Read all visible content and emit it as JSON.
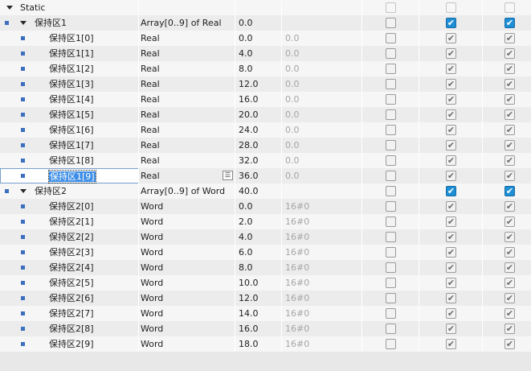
{
  "section": {
    "label": "Static"
  },
  "colors": {
    "accent": "#1f8fd4",
    "marker": "#3c6fbf",
    "row_odd": "#ececec",
    "row_even": "#f6f6f6",
    "selection": "#3d8ee6"
  },
  "rows": [
    {
      "name": "保持区1",
      "type": "Array[0..9] of Real",
      "offset": "0.0",
      "start": "",
      "level": 0,
      "marker": true,
      "expanded": true,
      "checks": [
        "unchecked",
        "blue",
        "blue"
      ]
    },
    {
      "name": "保持区1[0]",
      "type": "Real",
      "offset": "0.0",
      "start": "0.0",
      "level": 1,
      "marker": true,
      "checks": [
        "unchecked",
        "checked",
        "checked"
      ]
    },
    {
      "name": "保持区1[1]",
      "type": "Real",
      "offset": "4.0",
      "start": "0.0",
      "level": 1,
      "marker": true,
      "checks": [
        "unchecked",
        "checked",
        "checked"
      ]
    },
    {
      "name": "保持区1[2]",
      "type": "Real",
      "offset": "8.0",
      "start": "0.0",
      "level": 1,
      "marker": true,
      "checks": [
        "unchecked",
        "checked",
        "checked"
      ]
    },
    {
      "name": "保持区1[3]",
      "type": "Real",
      "offset": "12.0",
      "start": "0.0",
      "level": 1,
      "marker": true,
      "checks": [
        "unchecked",
        "checked",
        "checked"
      ]
    },
    {
      "name": "保持区1[4]",
      "type": "Real",
      "offset": "16.0",
      "start": "0.0",
      "level": 1,
      "marker": true,
      "checks": [
        "unchecked",
        "checked",
        "checked"
      ]
    },
    {
      "name": "保持区1[5]",
      "type": "Real",
      "offset": "20.0",
      "start": "0.0",
      "level": 1,
      "marker": true,
      "checks": [
        "unchecked",
        "checked",
        "checked"
      ]
    },
    {
      "name": "保持区1[6]",
      "type": "Real",
      "offset": "24.0",
      "start": "0.0",
      "level": 1,
      "marker": true,
      "checks": [
        "unchecked",
        "checked",
        "checked"
      ]
    },
    {
      "name": "保持区1[7]",
      "type": "Real",
      "offset": "28.0",
      "start": "0.0",
      "level": 1,
      "marker": true,
      "checks": [
        "unchecked",
        "checked",
        "checked"
      ]
    },
    {
      "name": "保持区1[8]",
      "type": "Real",
      "offset": "32.0",
      "start": "0.0",
      "level": 1,
      "marker": true,
      "checks": [
        "unchecked",
        "checked",
        "checked"
      ]
    },
    {
      "name": "保持区1[9]",
      "type": "Real",
      "offset": "36.0",
      "start": "0.0",
      "level": 1,
      "marker": true,
      "editing": true,
      "checks": [
        "unchecked",
        "checked",
        "checked"
      ]
    },
    {
      "name": "保持区2",
      "type": "Array[0..9] of Word",
      "offset": "40.0",
      "start": "",
      "level": 0,
      "marker": true,
      "expanded": true,
      "checks": [
        "unchecked",
        "blue",
        "blue"
      ]
    },
    {
      "name": "保持区2[0]",
      "type": "Word",
      "offset": "0.0",
      "start": "16#0",
      "level": 1,
      "marker": true,
      "checks": [
        "unchecked",
        "checked",
        "checked"
      ]
    },
    {
      "name": "保持区2[1]",
      "type": "Word",
      "offset": "2.0",
      "start": "16#0",
      "level": 1,
      "marker": true,
      "checks": [
        "unchecked",
        "checked",
        "checked"
      ]
    },
    {
      "name": "保持区2[2]",
      "type": "Word",
      "offset": "4.0",
      "start": "16#0",
      "level": 1,
      "marker": true,
      "checks": [
        "unchecked",
        "checked",
        "checked"
      ]
    },
    {
      "name": "保持区2[3]",
      "type": "Word",
      "offset": "6.0",
      "start": "16#0",
      "level": 1,
      "marker": true,
      "checks": [
        "unchecked",
        "checked",
        "checked"
      ]
    },
    {
      "name": "保持区2[4]",
      "type": "Word",
      "offset": "8.0",
      "start": "16#0",
      "level": 1,
      "marker": true,
      "checks": [
        "unchecked",
        "checked",
        "checked"
      ]
    },
    {
      "name": "保持区2[5]",
      "type": "Word",
      "offset": "10.0",
      "start": "16#0",
      "level": 1,
      "marker": true,
      "checks": [
        "unchecked",
        "checked",
        "checked"
      ]
    },
    {
      "name": "保持区2[6]",
      "type": "Word",
      "offset": "12.0",
      "start": "16#0",
      "level": 1,
      "marker": true,
      "checks": [
        "unchecked",
        "checked",
        "checked"
      ]
    },
    {
      "name": "保持区2[7]",
      "type": "Word",
      "offset": "14.0",
      "start": "16#0",
      "level": 1,
      "marker": true,
      "checks": [
        "unchecked",
        "checked",
        "checked"
      ]
    },
    {
      "name": "保持区2[8]",
      "type": "Word",
      "offset": "16.0",
      "start": "16#0",
      "level": 1,
      "marker": true,
      "checks": [
        "unchecked",
        "checked",
        "checked"
      ]
    },
    {
      "name": "保持区2[9]",
      "type": "Word",
      "offset": "18.0",
      "start": "16#0",
      "level": 1,
      "marker": true,
      "checks": [
        "unchecked",
        "checked",
        "checked"
      ]
    }
  ]
}
